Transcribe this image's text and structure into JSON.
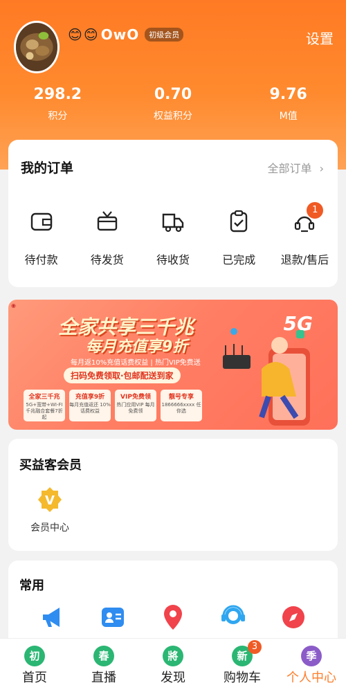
{
  "header": {
    "emojis": [
      "😊",
      "😊"
    ],
    "nickname": "OwO",
    "level_badge": "初级会员",
    "settings_label": "设置"
  },
  "stats": [
    {
      "value": "298.2",
      "label": "积分"
    },
    {
      "value": "0.70",
      "label": "权益积分"
    },
    {
      "value": "9.76",
      "label": "M值"
    }
  ],
  "orders": {
    "title": "我的订单",
    "all_label": "全部订单",
    "items": [
      {
        "label": "待付款",
        "icon": "wallet-icon"
      },
      {
        "label": "待发货",
        "icon": "package-icon"
      },
      {
        "label": "待收货",
        "icon": "truck-icon"
      },
      {
        "label": "已完成",
        "icon": "clipboard-check-icon"
      },
      {
        "label": "退款/售后",
        "icon": "refund-icon",
        "badge": "1"
      }
    ]
  },
  "banner": {
    "headline": "全家共享三千兆",
    "subheadline": "每月充值享9折",
    "sub_text": "每月返10%充值话费权益 | 热门VIP免费送",
    "pill": "扫码免费领取·包邮配送到家",
    "tag_5g": "5G",
    "coupons": [
      {
        "title": "全家三千兆",
        "desc": "5G+宽带+WI-FI 千兆融合套餐7折起"
      },
      {
        "title": "充值享9折",
        "desc": "每月充值返还 10%话费权益"
      },
      {
        "title": "VIP免费领",
        "desc": "热门应用VIP 每月免费领"
      },
      {
        "title": "靓号专享",
        "desc": "1866666xxxx 任你选"
      }
    ]
  },
  "member": {
    "title": "买益客会员",
    "item_label": "会员中心",
    "item_glyph": "V"
  },
  "common": {
    "title": "常用",
    "icons": [
      "megaphone-icon",
      "contact-card-icon",
      "location-pin-icon",
      "customer-service-icon",
      "compass-icon"
    ]
  },
  "tabbar": [
    {
      "label": "首页",
      "glyph": "初",
      "color": "#2bb673"
    },
    {
      "label": "直播",
      "glyph": "春",
      "color": "#2bb673"
    },
    {
      "label": "发现",
      "glyph": "將",
      "color": "#2bb673"
    },
    {
      "label": "购物车",
      "glyph": "新",
      "color": "#2bb673",
      "badge": "3"
    },
    {
      "label": "个人中心",
      "glyph": "季",
      "color": "#8b5cc8",
      "active": true
    }
  ],
  "colors": {
    "accent": "#ff7d2a",
    "badge": "#f05a24"
  }
}
